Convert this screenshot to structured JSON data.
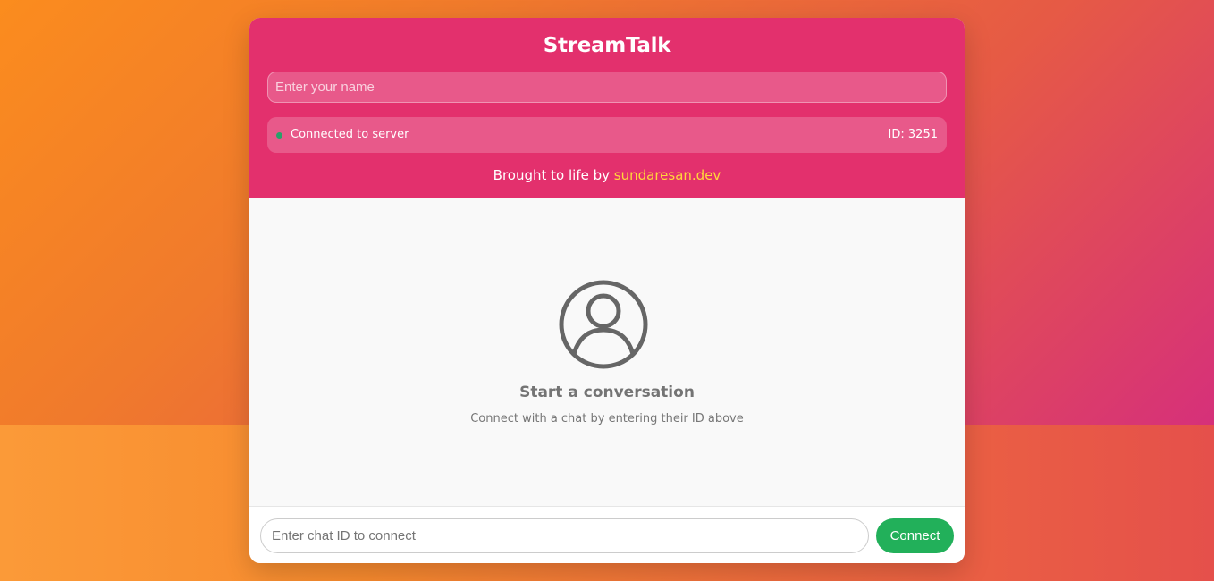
{
  "app": {
    "title": "StreamTalk"
  },
  "header": {
    "name_placeholder": "Enter your name",
    "status": {
      "text": "Connected to server",
      "id_label": "ID: 3251",
      "dot_color": "#2aa06a"
    },
    "credit": {
      "prefix": "Brought to life by",
      "link_text": "sundaresan.dev",
      "link_color": "#ffd83a"
    },
    "accent_color": "#e3306d"
  },
  "empty_state": {
    "icon": "user-avatar-icon",
    "title": "Start a conversation",
    "subtitle": "Connect with a chat by entering their ID above"
  },
  "footer": {
    "chat_id_placeholder": "Enter chat ID to connect",
    "connect_label": "Connect",
    "connect_color": "#22b05a"
  }
}
